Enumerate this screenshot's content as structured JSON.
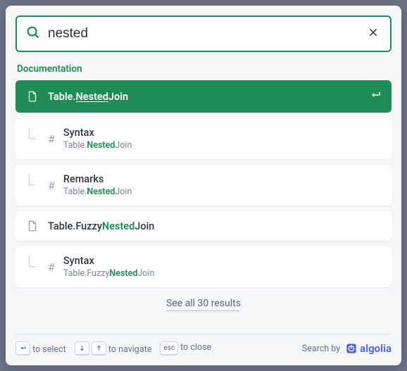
{
  "search": {
    "value": "nested",
    "placeholder": ""
  },
  "section_label": "Documentation",
  "results": [
    {
      "kind": "page",
      "title_parts": {
        "pre": "Table.",
        "hl": "Nested",
        "post": "Join"
      },
      "selected": true
    },
    {
      "kind": "anchor",
      "heading": "Syntax",
      "path_parts": {
        "pre": "Table.",
        "hl": "Nested",
        "post": "Join"
      }
    },
    {
      "kind": "anchor",
      "heading": "Remarks",
      "path_parts": {
        "pre": "Table.",
        "hl": "Nested",
        "post": "Join"
      }
    },
    {
      "kind": "page",
      "title_parts": {
        "pre": "Table.Fuzzy",
        "hl": "Nested",
        "post": "Join"
      }
    },
    {
      "kind": "anchor",
      "heading": "Syntax",
      "path_parts": {
        "pre": "Table.Fuzzy",
        "hl": "Nested",
        "post": "Join"
      }
    }
  ],
  "see_all": {
    "label": "See all 30 results",
    "count": 30
  },
  "footer": {
    "select_label": "to select",
    "navigate_label": "to navigate",
    "close_label": "to close",
    "esc_key": "esc",
    "search_by": "Search by",
    "provider": "algolia"
  }
}
